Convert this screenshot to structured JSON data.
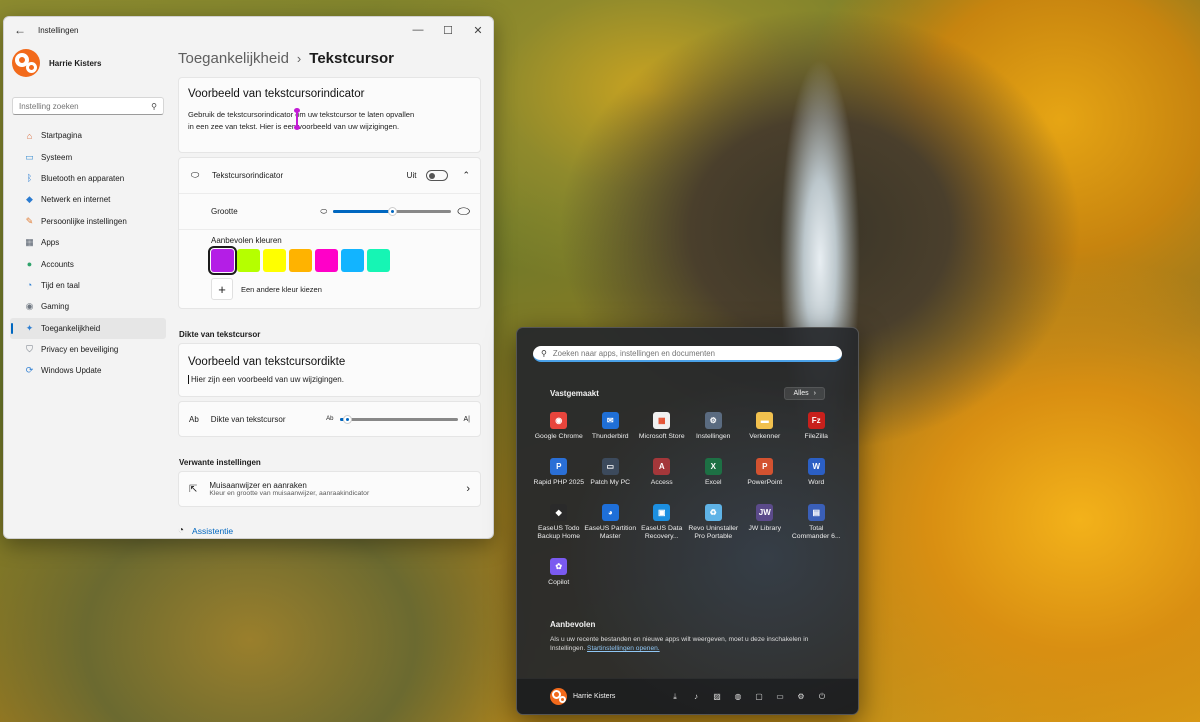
{
  "settings": {
    "app_title": "Instellingen",
    "user_name": "Harrie Kisters",
    "search_placeholder": "Instelling zoeken",
    "nav": [
      {
        "label": "Startpagina",
        "icon": "home-icon",
        "color": "#d86a3c",
        "glyph": "⌂"
      },
      {
        "label": "Systeem",
        "icon": "system-icon",
        "color": "#3a8ed0",
        "glyph": "▭"
      },
      {
        "label": "Bluetooth en apparaten",
        "icon": "bluetooth-icon",
        "color": "#2f7fd2",
        "glyph": "ᛒ"
      },
      {
        "label": "Netwerk en internet",
        "icon": "network-icon",
        "color": "#2b7bd0",
        "glyph": "◆"
      },
      {
        "label": "Persoonlijke instellingen",
        "icon": "brush-icon",
        "color": "#e07a30",
        "glyph": "✎"
      },
      {
        "label": "Apps",
        "icon": "apps-icon",
        "color": "#5a6370",
        "glyph": "▦"
      },
      {
        "label": "Accounts",
        "icon": "accounts-icon",
        "color": "#2fa36b",
        "glyph": "●"
      },
      {
        "label": "Tijd en taal",
        "icon": "time-language-icon",
        "color": "#2f7fd2",
        "glyph": "◔"
      },
      {
        "label": "Gaming",
        "icon": "gaming-icon",
        "color": "#6e7680",
        "glyph": "◉"
      },
      {
        "label": "Toegankelijkheid",
        "icon": "accessibility-icon",
        "color": "#2f7fd2",
        "glyph": "✦"
      },
      {
        "label": "Privacy en beveiliging",
        "icon": "shield-icon",
        "color": "#6e7680",
        "glyph": "⛉"
      },
      {
        "label": "Windows Update",
        "icon": "windows-update-icon",
        "color": "#2f7fd2",
        "glyph": "⟳"
      }
    ],
    "active_index": 9,
    "breadcrumb_parent": "Toegankelijkheid",
    "breadcrumb_current": "Tekstcursor",
    "preview_title": "Voorbeeld van tekstcursorindicator",
    "preview_text_line1": "Gebruik de tekstcursorindicator om uw tekstcursor te laten opvallen",
    "preview_text_line2": "in een zee van tekst. Hier is een voorbeeld van uw wijzigingen.",
    "indicator_label": "Tekstcursorindicator",
    "indicator_state": "Uit",
    "size_label": "Grootte",
    "size_value": 0.5,
    "colors_label": "Aanbevolen kleuren",
    "colors": [
      "#b41ee6",
      "#b5ff00",
      "#ffff00",
      "#ffb300",
      "#ff00c8",
      "#12b4ff",
      "#16f5b4"
    ],
    "selected_color": 0,
    "custom_color_label": "Een andere kleur kiezen",
    "thickness_section": "Dikte van tekstcursor",
    "thickness_preview_title": "Voorbeeld van tekstcursordikte",
    "thickness_preview_text": "Hier zijn een voorbeeld van uw wijzigingen.",
    "thickness_label": "Dikte van tekstcursor",
    "thickness_value": 0.07,
    "related_section": "Verwante instellingen",
    "related_title": "Muisaanwijzer en aanraken",
    "related_subtitle": "Kleur en grootte van muisaanwijzer, aanraakindicator",
    "assist_label": "Assistentie"
  },
  "start": {
    "search_placeholder": "Zoeken naar apps, instellingen en documenten",
    "pinned_title": "Vastgemaakt",
    "all_label": "Alles",
    "apps": [
      {
        "label": "Google Chrome",
        "icon": "chrome-icon",
        "color": "#e8453c",
        "glyph": "◉"
      },
      {
        "label": "Thunderbird",
        "icon": "thunderbird-icon",
        "color": "#1f6fd6",
        "glyph": "✉"
      },
      {
        "label": "Microsoft Store",
        "icon": "store-icon",
        "color": "#f0f0f0",
        "glyph": "▦"
      },
      {
        "label": "Instellingen",
        "icon": "settings-gear-icon",
        "color": "#5a6b80",
        "glyph": "⚙"
      },
      {
        "label": "Verkenner",
        "icon": "folder-icon",
        "color": "#f2c14e",
        "glyph": "▬"
      },
      {
        "label": "FileZilla",
        "icon": "filezilla-icon",
        "color": "#c8201c",
        "glyph": "Fz"
      },
      {
        "label": "Rapid PHP 2025",
        "icon": "rapid-php-icon",
        "color": "#2a6fd6",
        "glyph": "P"
      },
      {
        "label": "Patch My PC",
        "icon": "patch-my-pc-icon",
        "color": "#3c4a5c",
        "glyph": "▭"
      },
      {
        "label": "Access",
        "icon": "access-icon",
        "color": "#a4373a",
        "glyph": "A"
      },
      {
        "label": "Excel",
        "icon": "excel-icon",
        "color": "#1d7044",
        "glyph": "X"
      },
      {
        "label": "PowerPoint",
        "icon": "powerpoint-icon",
        "color": "#d35230",
        "glyph": "P"
      },
      {
        "label": "Word",
        "icon": "word-icon",
        "color": "#2b5fc4",
        "glyph": "W"
      },
      {
        "label": "EaseUS Todo Backup Home",
        "icon": "easeus-backup-icon",
        "color": "#2a2a2a",
        "glyph": "◆"
      },
      {
        "label": "EaseUS Partition Master",
        "icon": "easeus-partition-icon",
        "color": "#1e6fd9",
        "glyph": "◕"
      },
      {
        "label": "EaseUS Data Recovery...",
        "icon": "easeus-recovery-icon",
        "color": "#1c8fe0",
        "glyph": "▣"
      },
      {
        "label": "Revo Uninstaller Pro Portable",
        "icon": "revo-uninstaller-icon",
        "color": "#5fb3e6",
        "glyph": "♻"
      },
      {
        "label": "JW Library",
        "icon": "jw-library-icon",
        "color": "#5b4a8a",
        "glyph": "JW"
      },
      {
        "label": "Total Commander 6...",
        "icon": "total-commander-icon",
        "color": "#3a5fb8",
        "glyph": "▤"
      },
      {
        "label": "Copilot",
        "icon": "copilot-icon",
        "color": "#7a5af0",
        "glyph": "✿"
      }
    ],
    "recommended_title": "Aanbevolen",
    "recommended_text": "Als u uw recente bestanden en nieuwe apps wilt weergeven, moet u deze inschakelen in Instellingen.",
    "recommended_link": "Startinstellingen openen.",
    "user_name": "Harrie Kisters",
    "footer_icons": [
      {
        "name": "downloads-icon",
        "glyph": "⤓"
      },
      {
        "name": "music-icon",
        "glyph": "♪"
      },
      {
        "name": "pictures-icon",
        "glyph": "▨"
      },
      {
        "name": "network-globe-icon",
        "glyph": "◍"
      },
      {
        "name": "folder-personal-icon",
        "glyph": "▢"
      },
      {
        "name": "explorer-icon",
        "glyph": "▭"
      },
      {
        "name": "settings-icon",
        "glyph": "⚙"
      },
      {
        "name": "power-icon",
        "glyph": "⏻"
      }
    ]
  }
}
